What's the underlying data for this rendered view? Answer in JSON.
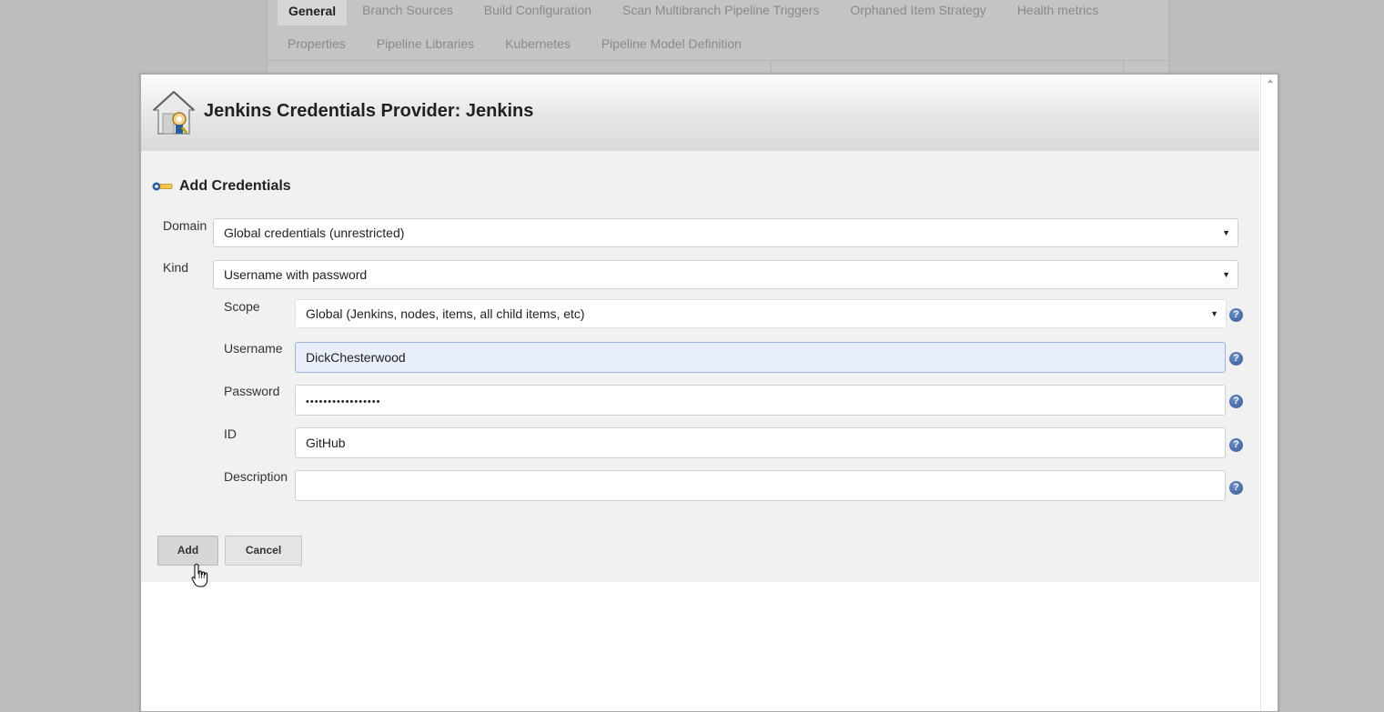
{
  "background_tabs": {
    "row1": [
      "General",
      "Branch Sources",
      "Build Configuration",
      "Scan Multibranch Pipeline Triggers",
      "Orphaned Item Strategy",
      "Health metrics"
    ],
    "row2": [
      "Properties",
      "Pipeline Libraries",
      "Kubernetes",
      "Pipeline Model Definition"
    ],
    "active": "General"
  },
  "dialog": {
    "title": "Jenkins Credentials Provider: Jenkins",
    "section_title": "Add Credentials",
    "icons": {
      "logo": "jenkins-credentials-house-icon",
      "section": "key-icon",
      "help": "help-icon"
    }
  },
  "form": {
    "domain": {
      "label": "Domain",
      "value": "Global credentials (unrestricted)"
    },
    "kind": {
      "label": "Kind",
      "value": "Username with password"
    },
    "scope": {
      "label": "Scope",
      "value": "Global (Jenkins, nodes, items, all child items, etc)"
    },
    "username": {
      "label": "Username",
      "value": "DickChesterwood"
    },
    "password": {
      "label": "Password",
      "value": "•••••••••••••••••"
    },
    "id": {
      "label": "ID",
      "value": "GitHub"
    },
    "description": {
      "label": "Description",
      "value": ""
    },
    "help_symbol": "?",
    "select_caret": "▼"
  },
  "buttons": {
    "add": "Add",
    "cancel": "Cancel"
  },
  "colors": {
    "help_blue": "#3a62a7",
    "highlight_field": "#e8eefa",
    "overlay": "#bdbdbd"
  }
}
